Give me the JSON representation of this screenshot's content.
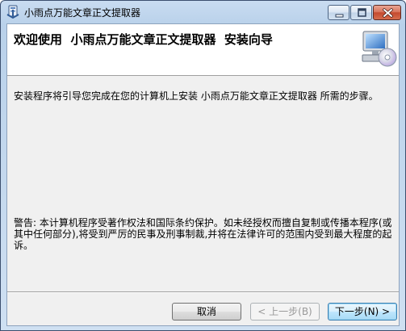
{
  "window": {
    "title": "小雨点万能文章正文提取器",
    "icons": {
      "app": "installer-icon",
      "minimize": "minimize-icon",
      "maximize": "maximize-icon",
      "close": "close-icon"
    }
  },
  "header": {
    "title": "欢迎使用  小雨点万能文章正文提取器  安装向导",
    "graphic": "computer-cd-icon"
  },
  "body": {
    "intro": "安装程序将引导您完成在您的计算机上安装 小雨点万能文章正文提取器 所需的步骤。",
    "warning": "警告: 本计算机程序受著作权法和国际条约保护。如未经授权而擅自复制或传播本程序(或其中任何部分),将受到严厉的民事及刑事制裁,并将在法律许可的范围内受到最大程度的起诉。"
  },
  "buttons": {
    "cancel": "取消",
    "back": "< 上一步(B)",
    "next": "下一步(N) >"
  },
  "colors": {
    "title_bar": "#b9d1ea",
    "client_background": "#f0f0f0",
    "header_background": "#ffffff",
    "close_button": "#c44a2f",
    "default_button_border": "#3c7fb1"
  }
}
